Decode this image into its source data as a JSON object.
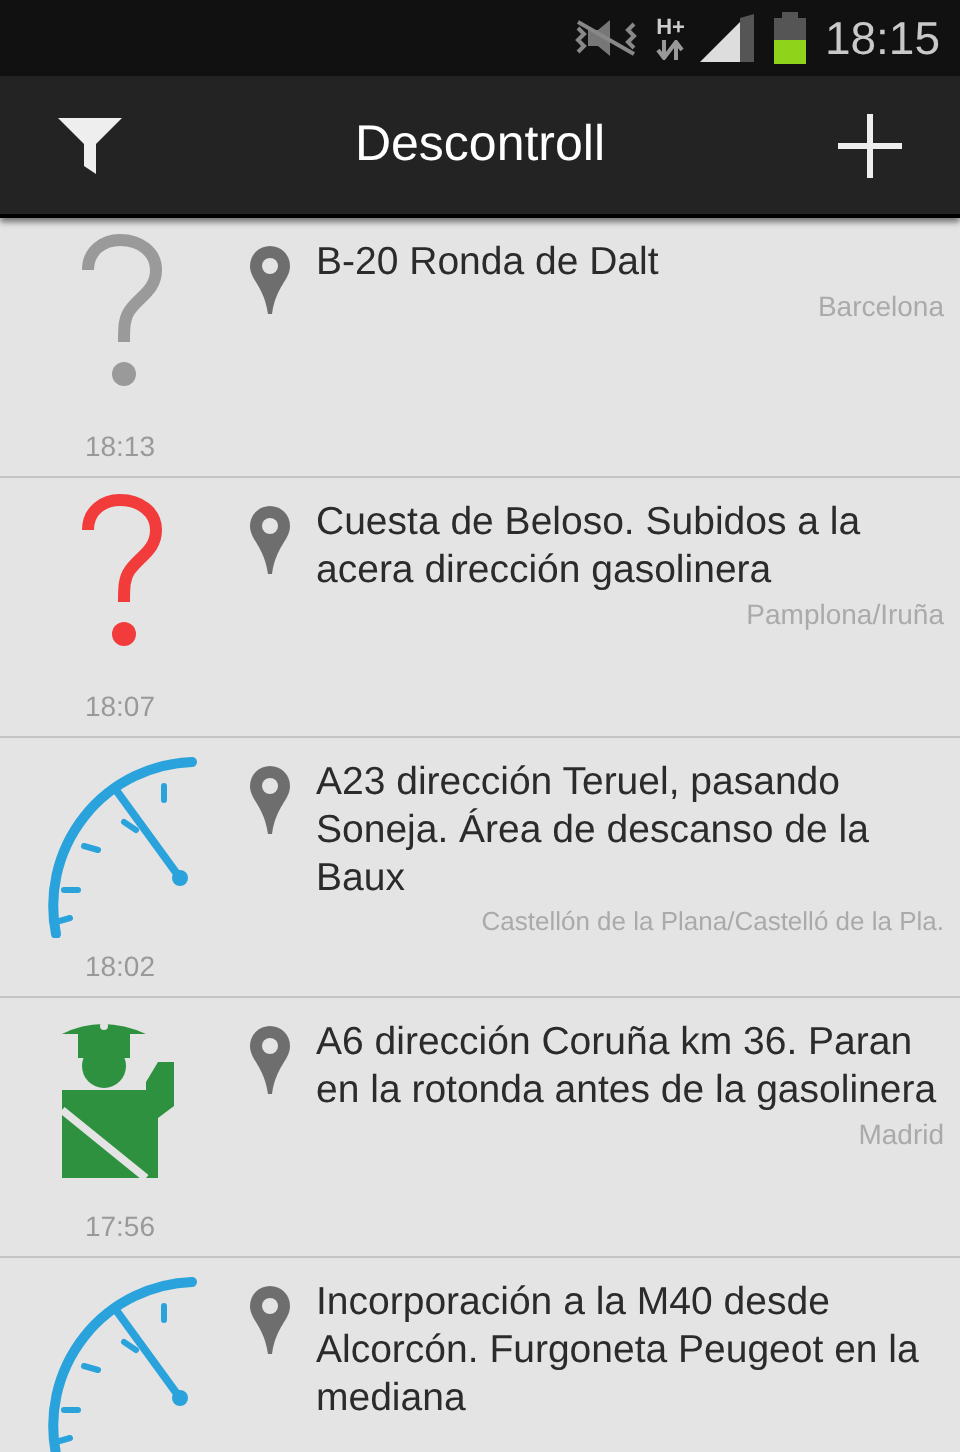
{
  "status_bar": {
    "network": "H+",
    "time": "18:15"
  },
  "action_bar": {
    "title": "Descontroll"
  },
  "reports": [
    {
      "kind": "unknown",
      "time": "18:13",
      "text": "B-20 Ronda de Dalt",
      "city": "Barcelona"
    },
    {
      "kind": "question",
      "time": "18:07",
      "text": "Cuesta de Beloso. Subidos a la acera dirección gasolinera",
      "city": "Pamplona/Iruña"
    },
    {
      "kind": "radar",
      "time": "18:02",
      "text": "A23 dirección Teruel, pasando Soneja. Área de descanso de la Baux",
      "city": "Castellón de la Plana/Castelló de la Pla."
    },
    {
      "kind": "police",
      "time": "17:56",
      "text": "A6 dirección Coruña km 36. Paran en la rotonda antes de la gasolinera",
      "city": "Madrid"
    },
    {
      "kind": "radar",
      "text": "Incorporación a la M40 desde Alcorcón. Furgoneta Peugeot en la mediana"
    }
  ]
}
